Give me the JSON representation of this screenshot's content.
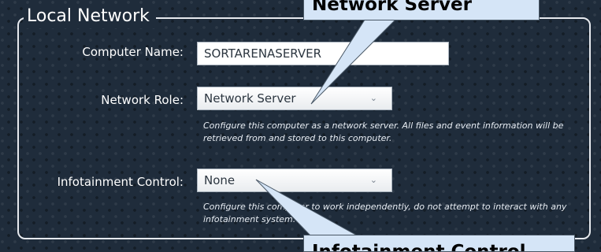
{
  "section": {
    "title": "Local Network"
  },
  "computer_name": {
    "label": "Computer Name:",
    "value": "SORTARENASERVER"
  },
  "network_role": {
    "label": "Network Role:",
    "selected": "Network Server",
    "description": "Configure this computer as a network server.  All files and event information will be retrieved from and stored to this computer."
  },
  "infotainment": {
    "label": "Infotainment Control:",
    "selected": "None",
    "description": "Configure this computer to work independently, do not attempt to interact with any infotainment system."
  },
  "callouts": {
    "top": "Network Server",
    "bottom": "Infotainment Control"
  },
  "icons": {
    "dropdown": "chevron-down-icon"
  },
  "colors": {
    "background": "#1f2c3b",
    "callout_fill": "#d5e5f7",
    "border": "#e6e9ee"
  }
}
